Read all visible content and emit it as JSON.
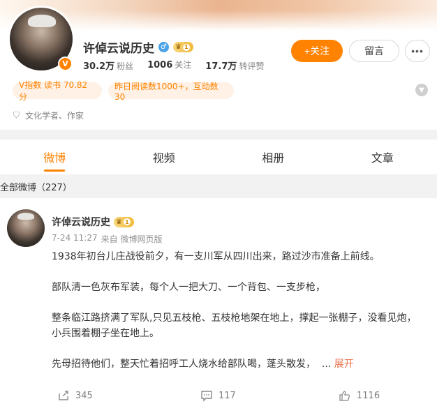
{
  "profile": {
    "name": "许倬云说历史",
    "gender_icon": "male-icon",
    "level": "1",
    "stats": [
      {
        "num": "30.2万",
        "label": "粉丝"
      },
      {
        "num": "1006",
        "label": "关注"
      },
      {
        "num": "17.7万",
        "label": "转评赞"
      }
    ],
    "follow_label": "+关注",
    "message_label": "留言",
    "more_label": "•••",
    "pills": [
      "V指数 读书 70.82分",
      "昨日阅读数1000+，互动数30"
    ],
    "tagline": "文化学者、作家",
    "verified_badge": "V"
  },
  "tabs": [
    {
      "label": "微博",
      "active": true
    },
    {
      "label": "视频",
      "active": false
    },
    {
      "label": "相册",
      "active": false
    },
    {
      "label": "文章",
      "active": false
    }
  ],
  "all_posts_label": "全部微博（227）",
  "post": {
    "author": "许倬云说历史",
    "level": "1",
    "time": "7-24 11:27",
    "source": "来自 微博网页版",
    "paragraphs": [
      "1938年初台儿庄战役前夕，有一支川军从四川出来，路过沙市准备上前线。",
      "部队清一色灰布军装，每个人一把大刀、一个背包、一支步枪，",
      "整条临江路挤满了军队,只见五枝枪、五枝枪地架在地上，撑起一张棚子，没看见炮，小兵围着棚子坐在地上。"
    ],
    "last_paragraph": "先母招待他们，整天忙着招呼工人烧水给部队喝，蓬头散发，",
    "ellipsis": "...",
    "expand_label": "展开",
    "reposts": "345",
    "comments": "117",
    "likes": "1116"
  },
  "colors": {
    "accent": "#ff8200",
    "pill_bg": "#fff1e5",
    "expand": "#eb7350"
  }
}
